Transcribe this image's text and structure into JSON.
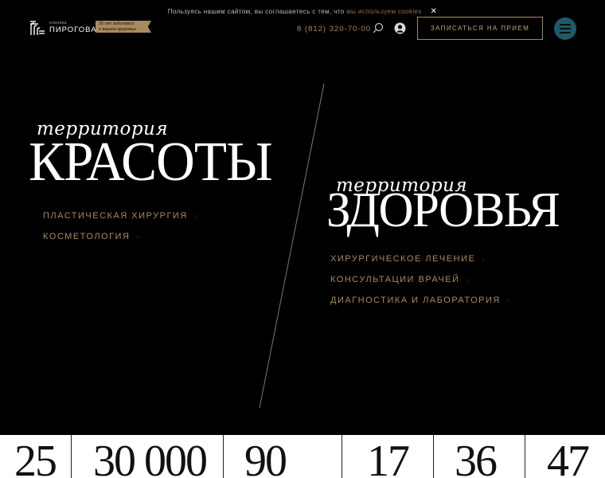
{
  "cookie": {
    "text": "Пользуясь нашим сайтом, вы соглашаетесь с тем, что ",
    "link": "мы используем cookies"
  },
  "logo": {
    "small": "клиника",
    "big": "ПИРОГОВА",
    "badge_line1": "25 лет заботимся",
    "badge_line2": "о вашем здоровье"
  },
  "header": {
    "phone": "8 (812) 320-70-00",
    "cta": "Записаться на прием"
  },
  "hero": {
    "left": {
      "script": "территория",
      "title": "КРАСОТЫ",
      "links": [
        "ПЛАСТИЧЕСКАЯ ХИРУРГИЯ",
        "КОСМЕТОЛОГИЯ"
      ]
    },
    "right": {
      "script": "территория",
      "title": "ЗДОРОВЬЯ",
      "links": [
        "ХИРУРГИЧЕСКОЕ ЛЕЧЕНИЕ",
        "КОНСУЛЬТАЦИИ ВРАЧЕЙ",
        "ДИАГНОСТИКА И ЛАБОРАТОРИЯ"
      ]
    }
  },
  "stats": [
    "25",
    "30 000",
    "90",
    "17",
    "36",
    "47"
  ],
  "colors": {
    "background": "#000000",
    "gold": "#a98a5c",
    "menu_circle": "#1d5b67"
  }
}
